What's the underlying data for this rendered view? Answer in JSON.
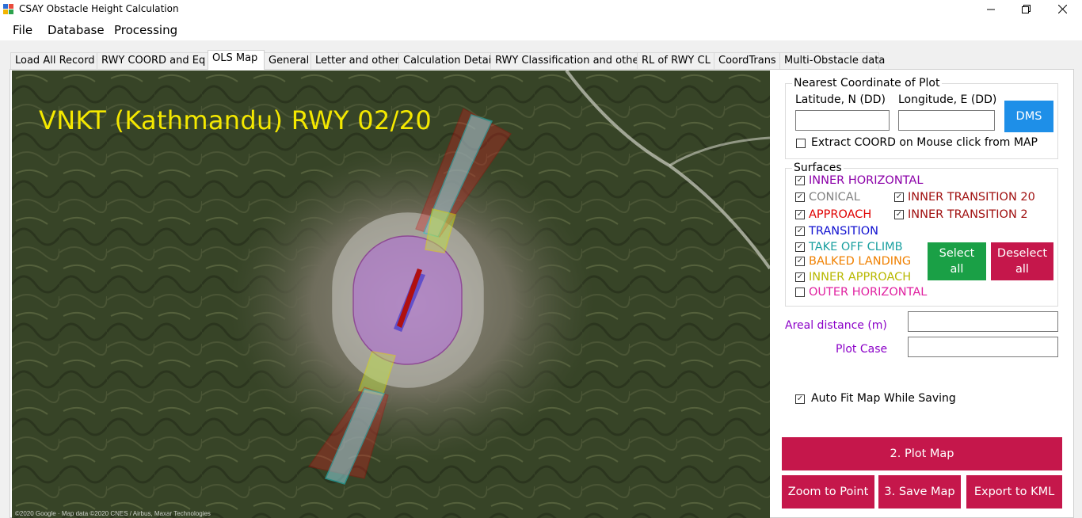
{
  "window": {
    "title": "CSAY Obstacle Height Calculation",
    "controls": [
      "minimize",
      "restore",
      "close"
    ]
  },
  "menu": [
    "File",
    "Database",
    "Processing"
  ],
  "tabs": [
    {
      "label": "Load All Record",
      "active": false
    },
    {
      "label": "RWY COORD and Eq",
      "active": false
    },
    {
      "label": "OLS Map",
      "active": true
    },
    {
      "label": "General",
      "active": false
    },
    {
      "label": "Letter and others",
      "active": false
    },
    {
      "label": "Calculation Detail",
      "active": false
    },
    {
      "label": "RWY Classification and other",
      "active": false
    },
    {
      "label": "RL of RWY CL",
      "active": false
    },
    {
      "label": "CoordTrans",
      "active": false
    },
    {
      "label": "Multi-Obstacle data",
      "active": false
    }
  ],
  "map": {
    "title": "VNKT (Kathmandu) RWY 02/20",
    "attribution": "©2020 Google · Map data ©2020 CNES / Airbus, Maxar Technologies"
  },
  "coords": {
    "legend": "Nearest Coordinate of Plot",
    "lat_label": "Latitude, N (DD)",
    "lon_label": "Longitude, E (DD)",
    "lat_value": "",
    "lon_value": "",
    "dms_button": "DMS",
    "extract_label": "Extract COORD on Mouse click from MAP",
    "extract_checked": false
  },
  "surfaces": {
    "legend": "Surfaces",
    "items": [
      {
        "label": "INNER HORIZONTAL",
        "checked": true,
        "color": "#8b00a8"
      },
      {
        "label": "CONICAL",
        "checked": true,
        "color": "#808080"
      },
      {
        "label": "INNER TRANSITION 20",
        "checked": true,
        "color": "#a01010"
      },
      {
        "label": "APPROACH",
        "checked": true,
        "color": "#e00000"
      },
      {
        "label": "INNER TRANSITION 2",
        "checked": true,
        "color": "#a01010"
      },
      {
        "label": "TRANSITION",
        "checked": true,
        "color": "#1010d0"
      },
      {
        "label": "TAKE OFF CLIMB",
        "checked": true,
        "color": "#1aa0a0"
      },
      {
        "label": "BALKED LANDING",
        "checked": true,
        "color": "#f08000"
      },
      {
        "label": "INNER APPROACH",
        "checked": true,
        "color": "#b8b800"
      },
      {
        "label": "OUTER HORIZONTAL",
        "checked": false,
        "color": "#e020a0"
      }
    ],
    "select_all": "Select all",
    "deselect_all": "Deselect all"
  },
  "areal_distance": {
    "label": "Areal distance (m)",
    "value": ""
  },
  "plot_case": {
    "label": "Plot Case",
    "value": ""
  },
  "auto_fit": {
    "label": "Auto Fit Map While Saving",
    "checked": true
  },
  "buttons": {
    "plot_map": "2. Plot Map",
    "zoom_to_point": "Zoom to Point",
    "save_map": "3. Save Map",
    "export_kml": "Export to KML"
  },
  "colors": {
    "accent_button": "#c5174b",
    "dms_button": "#1e8fe8",
    "select_button": "#1aa046",
    "label_purple": "#8b00c8",
    "map_title": "#f4e800"
  }
}
